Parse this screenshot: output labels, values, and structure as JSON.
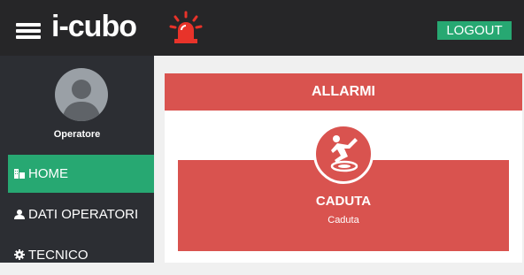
{
  "header": {
    "logo": "i-cubo",
    "logout_label": "LOGOUT",
    "alarm_color": "#e8332a",
    "accent": "#27a872"
  },
  "sidebar": {
    "username": "Operatore",
    "items": [
      {
        "label": "HOME",
        "icon": "building-icon",
        "active": true
      },
      {
        "label": "DATI OPERATORI",
        "icon": "user-icon",
        "active": false
      },
      {
        "label": "TECNICO",
        "icon": "gear-icon",
        "active": false
      }
    ]
  },
  "main": {
    "panel_title": "ALLARMI",
    "alarm": {
      "title": "CADUTA",
      "subtitle": "Caduta",
      "icon": "fall-icon",
      "color": "#d9534f"
    }
  }
}
